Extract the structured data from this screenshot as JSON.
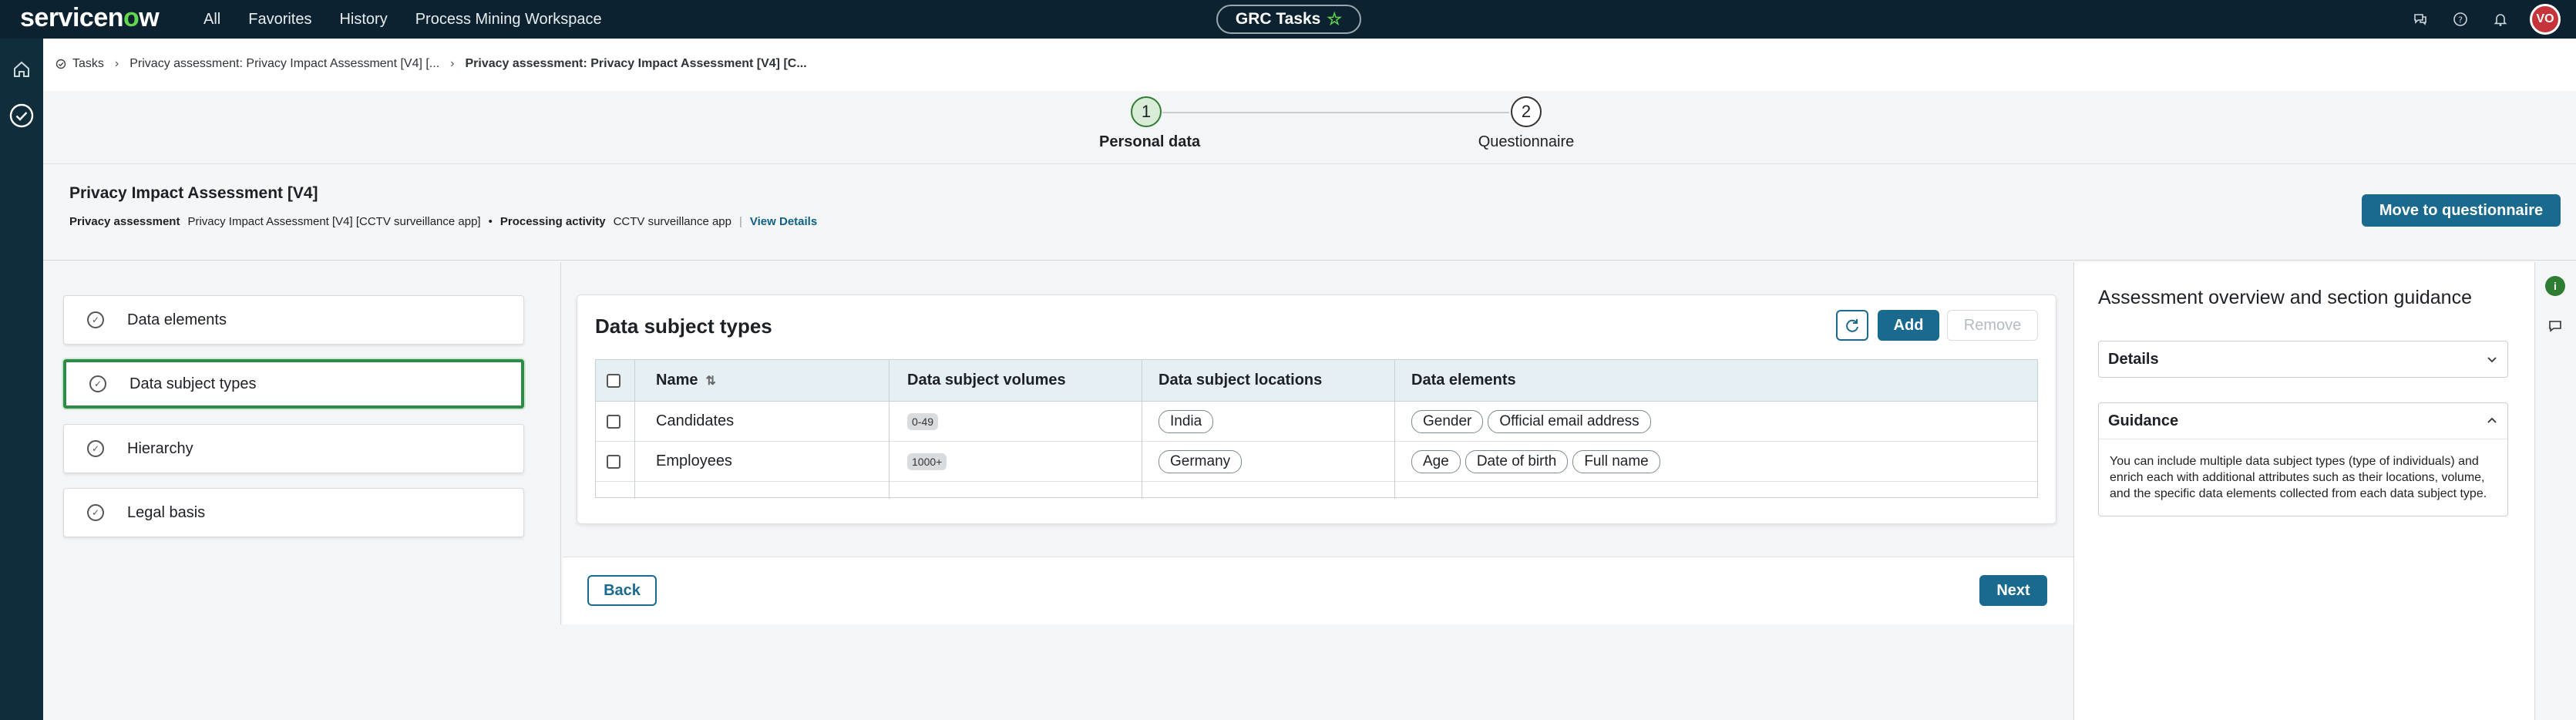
{
  "topbar": {
    "logo_text_a": "servicen",
    "logo_o": "o",
    "logo_text_b": "w",
    "nav": [
      "All",
      "Favorites",
      "History",
      "Process Mining Workspace"
    ],
    "workspace_pill": "GRC Tasks",
    "avatar_initials": "VO",
    "icons": [
      "chat-icon",
      "help-icon",
      "bell-icon"
    ]
  },
  "breadcrumb": {
    "items": [
      "Tasks",
      "Privacy assessment: Privacy Impact Assessment [V4] [...",
      "Privacy assessment: Privacy Impact Assessment [V4] [C..."
    ]
  },
  "stepper": {
    "steps": [
      {
        "number": "1",
        "label": "Personal data",
        "active": true
      },
      {
        "number": "2",
        "label": "Questionnaire",
        "active": false
      }
    ]
  },
  "header": {
    "title": "Privacy Impact Assessment [V4]",
    "assessment_label": "Privacy assessment",
    "assessment_value": "Privacy Impact Assessment [V4] [CCTV surveillance app]",
    "bullet": "•",
    "activity_label": "Processing activity",
    "activity_value": "CCTV surveillance app",
    "divider": "|",
    "view_details": "View Details",
    "move_button": "Move to questionnaire"
  },
  "sections": [
    {
      "label": "Data elements",
      "active": false
    },
    {
      "label": "Data subject types",
      "active": true
    },
    {
      "label": "Hierarchy",
      "active": false
    },
    {
      "label": "Legal basis",
      "active": false
    }
  ],
  "card": {
    "title": "Data subject types",
    "add_label": "Add",
    "remove_label": "Remove",
    "columns": [
      "Name",
      "Data subject volumes",
      "Data subject locations",
      "Data elements"
    ],
    "rows": [
      {
        "name": "Candidates",
        "volume": "0-49",
        "locations": [
          "India"
        ],
        "elements": [
          "Gender",
          "Official email address"
        ]
      },
      {
        "name": "Employees",
        "volume": "1000+",
        "locations": [
          "Germany"
        ],
        "elements": [
          "Age",
          "Date of birth",
          "Full name"
        ]
      }
    ]
  },
  "footer": {
    "back_label": "Back",
    "next_label": "Next"
  },
  "guidance": {
    "title": "Assessment overview and section guidance",
    "details_label": "Details",
    "guidance_label": "Guidance",
    "guidance_text": "You can include multiple data subject types (type of individuals) and enrich each with additional attributes such as their locations, volume, and the specific data elements collected from each data subject type."
  },
  "colors": {
    "topbar_bg": "#0c2230",
    "brand_green": "#62d84e",
    "primary_button": "#1a6a90",
    "active_border": "#2e8a46"
  }
}
